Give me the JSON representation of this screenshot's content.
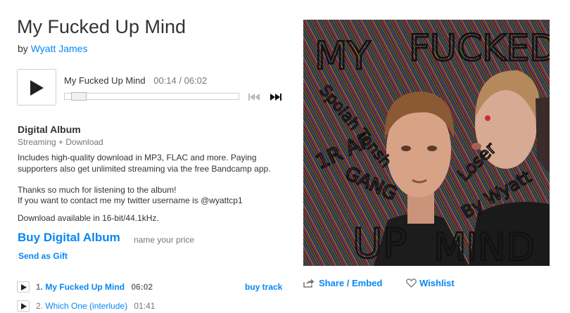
{
  "album": {
    "title": "My Fucked Up Mind",
    "by_prefix": "by",
    "artist": "Wyatt James"
  },
  "player": {
    "track_title": "My Fucked Up Mind",
    "time": "00:14 / 06:02",
    "progress_fraction": 0.039,
    "play_icon": "play-icon",
    "prev_icon": "previous-track-icon",
    "next_icon": "next-track-icon"
  },
  "package": {
    "title": "Digital Album",
    "subtitle": "Streaming + Download",
    "desc_line1": "Includes high-quality download in MP3, FLAC and more. Paying",
    "desc_line2": "supporters also get unlimited streaming via the free Bandcamp app.",
    "thanks_line1": "Thanks so much for listening to the album!",
    "thanks_line2": "If you want to contact me my twitter username is @wyattcp1",
    "download_info": "Download available in 16-bit/44.1kHz.",
    "buy_label": "Buy Digital Album",
    "price_note": "name your price",
    "gift_label": "Send as Gift"
  },
  "tracks": [
    {
      "number": "1.",
      "name": "My Fucked Up Mind",
      "duration": "06:02",
      "buy_label": "buy track"
    },
    {
      "number": "2.",
      "name": "Which One (interlude)",
      "duration": "01:41"
    }
  ],
  "cover_art": {
    "text_top_left": "MY",
    "text_top_right": "FUCKED",
    "text_bottom_left": "UP",
    "text_bottom_right": "MIND",
    "scribble_1": "Spoiah Tonsh",
    "scribble_2": "1R AF",
    "scribble_3": "GANG",
    "scribble_4": "Loser",
    "scribble_5": "By Wyatt"
  },
  "actions": {
    "share_label": "Share / Embed",
    "share_icon": "share-icon",
    "wishlist_label": "Wishlist",
    "wishlist_icon": "heart-icon"
  },
  "colors": {
    "link": "#0687f5",
    "text": "#333333",
    "muted": "#777777"
  }
}
